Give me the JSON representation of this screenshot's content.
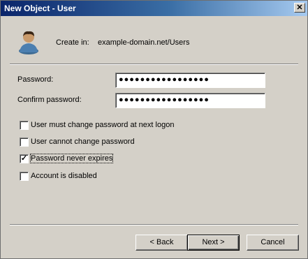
{
  "window": {
    "title": "New Object - User",
    "close_glyph": "✕"
  },
  "header": {
    "create_in_label": "Create in:",
    "create_in_path": "example-domain.net/Users",
    "icon": "user-avatar-icon"
  },
  "form": {
    "password_label": "Password:",
    "password_value": "●●●●●●●●●●●●●●●●●",
    "confirm_label": "Confirm password:",
    "confirm_value": "●●●●●●●●●●●●●●●●●"
  },
  "options": [
    {
      "label": "User must change password at next logon",
      "checked": false,
      "mark": ""
    },
    {
      "label": "User cannot change password",
      "checked": false,
      "mark": ""
    },
    {
      "label": "Password never expires",
      "checked": true,
      "mark": "✓"
    },
    {
      "label": "Account is disabled",
      "checked": false,
      "mark": ""
    }
  ],
  "buttons": {
    "back": "< Back",
    "next": "Next >",
    "cancel": "Cancel"
  }
}
